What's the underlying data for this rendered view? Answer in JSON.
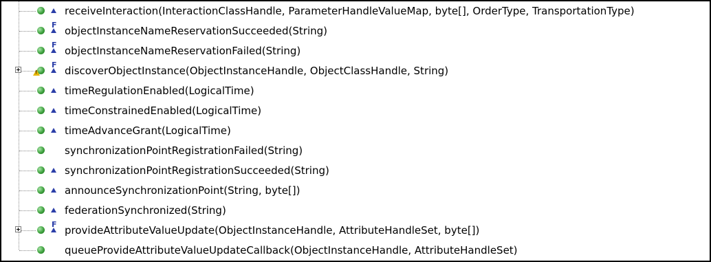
{
  "rows": [
    {
      "label": "receiveInteraction(InteractionClassHandle, ParameterHandleValueMap, byte[], OrderType, TransportationType)",
      "final": false,
      "override": true,
      "expandable": false,
      "warning": false
    },
    {
      "label": "objectInstanceNameReservationSucceeded(String)",
      "final": true,
      "override": true,
      "expandable": false,
      "warning": false
    },
    {
      "label": "objectInstanceNameReservationFailed(String)",
      "final": true,
      "override": true,
      "expandable": false,
      "warning": false
    },
    {
      "label": "discoverObjectInstance(ObjectInstanceHandle, ObjectClassHandle, String)",
      "final": true,
      "override": true,
      "expandable": true,
      "warning": true
    },
    {
      "label": "timeRegulationEnabled(LogicalTime)",
      "final": false,
      "override": true,
      "expandable": false,
      "warning": false
    },
    {
      "label": "timeConstrainedEnabled(LogicalTime)",
      "final": false,
      "override": true,
      "expandable": false,
      "warning": false
    },
    {
      "label": "timeAdvanceGrant(LogicalTime)",
      "final": false,
      "override": true,
      "expandable": false,
      "warning": false
    },
    {
      "label": "synchronizationPointRegistrationFailed(String)",
      "final": false,
      "override": false,
      "expandable": false,
      "warning": false
    },
    {
      "label": "synchronizationPointRegistrationSucceeded(String)",
      "final": false,
      "override": true,
      "expandable": false,
      "warning": false
    },
    {
      "label": "announceSynchronizationPoint(String, byte[])",
      "final": false,
      "override": true,
      "expandable": false,
      "warning": false
    },
    {
      "label": "federationSynchronized(String)",
      "final": false,
      "override": true,
      "expandable": false,
      "warning": false
    },
    {
      "label": "provideAttributeValueUpdate(ObjectInstanceHandle, AttributeHandleSet, byte[])",
      "final": true,
      "override": true,
      "expandable": true,
      "warning": false
    },
    {
      "label": "queueProvideAttributeValueUpdateCallback(ObjectInstanceHandle, AttributeHandleSet)",
      "final": false,
      "override": false,
      "expandable": false,
      "warning": false
    }
  ],
  "icons": {
    "method": "public-method-icon",
    "final": "final-modifier-icon",
    "override": "override-indicator-icon",
    "warning": "warning-icon",
    "expand": "expand-icon"
  },
  "final_glyph": "F"
}
